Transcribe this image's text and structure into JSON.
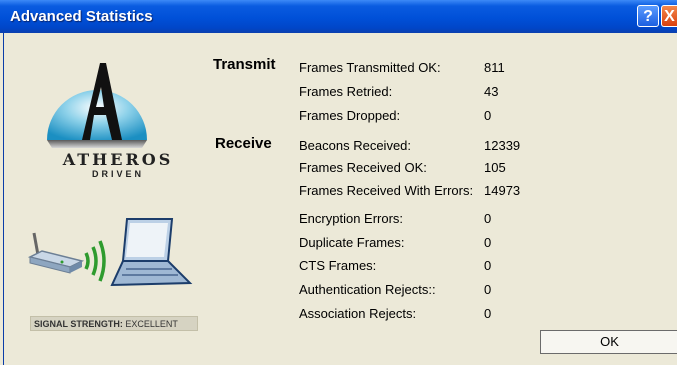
{
  "window": {
    "title": "Advanced Statistics",
    "help_label": "?",
    "close_label": "X"
  },
  "branding": {
    "logo_name": "ATHEROS",
    "logo_sub": "DRIVEN",
    "logo_icon": "atheros-a-logo-icon"
  },
  "signal": {
    "label": "SIGNAL STRENGTH:",
    "value": "EXCELLENT"
  },
  "transmit": {
    "heading": "Transmit",
    "rows": [
      {
        "label": "Frames Transmitted OK:",
        "value": "811"
      },
      {
        "label": "Frames Retried:",
        "value": "43"
      },
      {
        "label": "Frames Dropped:",
        "value": "0"
      }
    ]
  },
  "receive": {
    "heading": "Receive",
    "rows": [
      {
        "label": "Beacons Received:",
        "value": "12339"
      },
      {
        "label": "Frames Received OK:",
        "value": "105"
      },
      {
        "label": "Frames Received With Errors:",
        "value": "14973"
      },
      {
        "label": "Encryption Errors:",
        "value": "0"
      },
      {
        "label": "Duplicate Frames:",
        "value": "0"
      },
      {
        "label": "CTS Frames:",
        "value": "0"
      },
      {
        "label": "Authentication Rejects::",
        "value": "0"
      },
      {
        "label": "Association Rejects:",
        "value": "0"
      }
    ]
  },
  "buttons": {
    "ok_label": "OK"
  },
  "colors": {
    "titlebar": "#0050d8",
    "background": "#ece9d8",
    "signal_green": "#2e9b2e"
  }
}
